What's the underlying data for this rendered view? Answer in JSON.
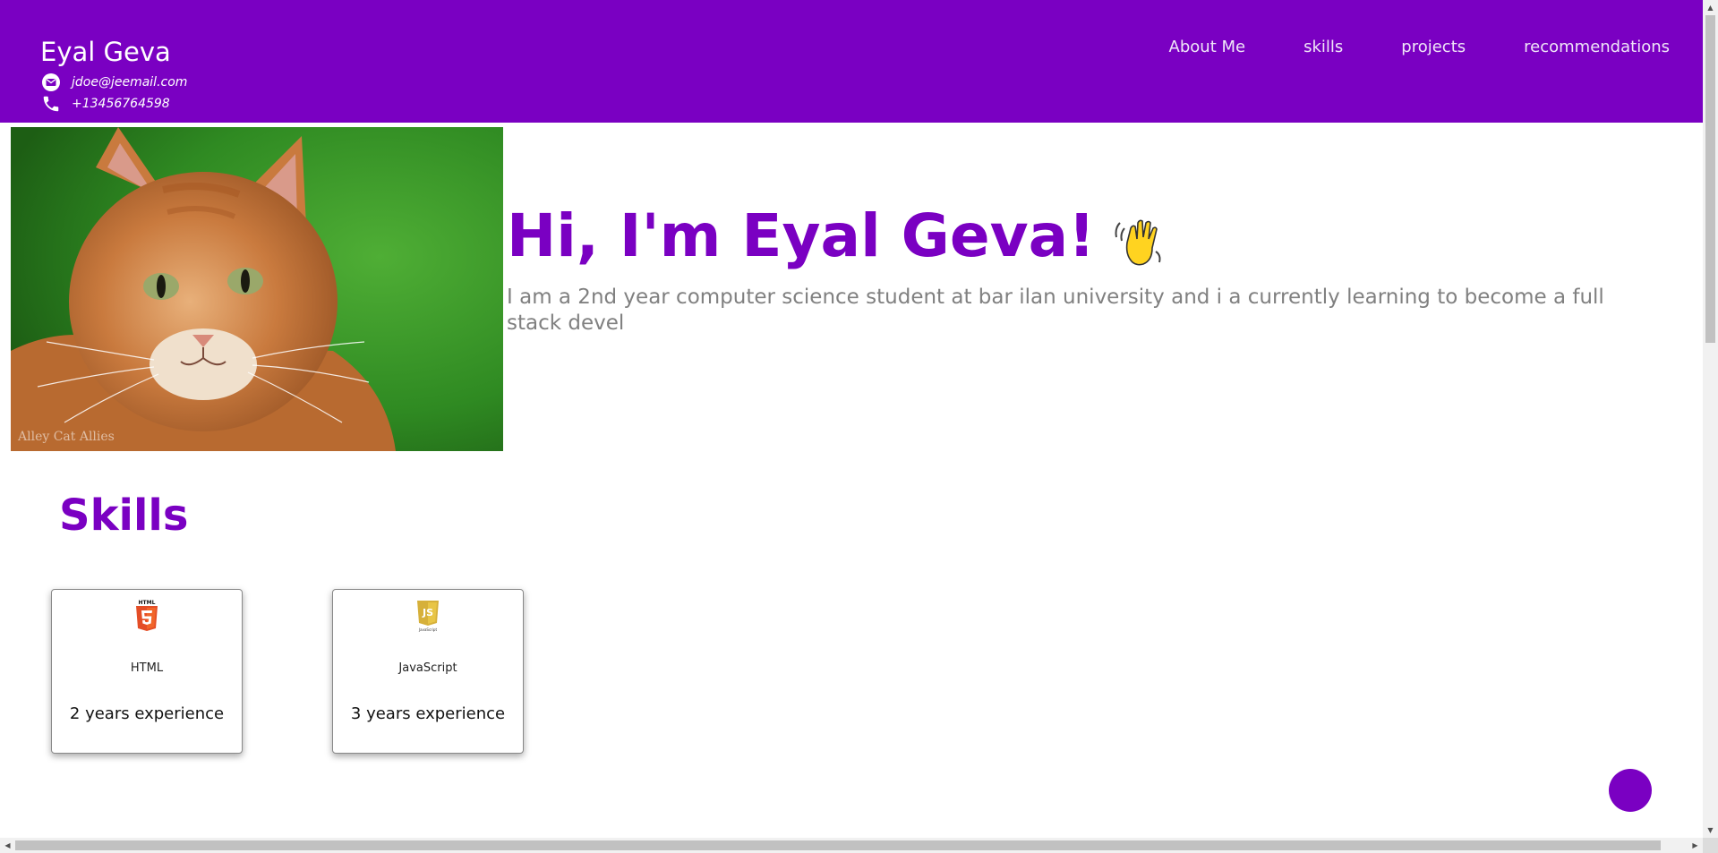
{
  "header": {
    "name": "Eyal Geva",
    "email": "jdoe@jeemail.com",
    "phone": "+13456764598",
    "nav": [
      "About Me",
      "skills",
      "projects",
      "recommendations"
    ]
  },
  "hero": {
    "title": "Hi, I'm Eyal Geva!",
    "description": "I am a 2nd year computer science student at bar ilan university and i a currently learning to become a full stack devel",
    "image_watermark": "Alley Cat Allies"
  },
  "skills": {
    "title": "Skills",
    "items": [
      {
        "name": "HTML",
        "experience": "2 years experience",
        "icon": "html5-icon"
      },
      {
        "name": "JavaScript",
        "experience": "3 years experience",
        "icon": "javascript-icon"
      }
    ]
  },
  "colors": {
    "primary": "#7a00c2",
    "description_text": "#808080"
  }
}
